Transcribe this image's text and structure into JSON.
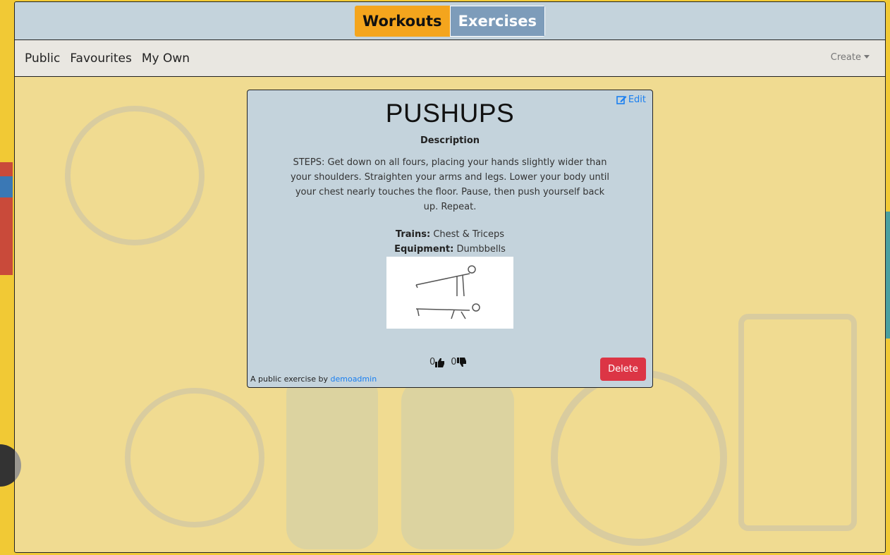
{
  "tabs": {
    "workouts": "Workouts",
    "exercises": "Exercises"
  },
  "nav": {
    "items": [
      "Public",
      "Favourites",
      "My Own"
    ],
    "create": "Create"
  },
  "exercise": {
    "edit_label": "Edit",
    "title": "PUSHUPS",
    "description_heading": "Description",
    "description": "STEPS: Get down on all fours, placing your hands slightly wider than your shoulders. Straighten your arms and legs. Lower your body until your chest nearly touches the floor. Pause, then push yourself back up. Repeat.",
    "trains_label": "Trains:",
    "trains": "Chest & Triceps",
    "equipment_label": "Equipment:",
    "equipment": "Dumbbells",
    "likes": "0",
    "dislikes": "0",
    "delete_label": "Delete",
    "author_prefix": "A public exercise by",
    "author": "demoadmin"
  },
  "colors": {
    "workouts_tab": "#f4a51d",
    "exercises_tab": "#7d9cba",
    "card_bg": "#c4d3dc",
    "delete": "#dc3545",
    "link": "#1a7ff0"
  }
}
